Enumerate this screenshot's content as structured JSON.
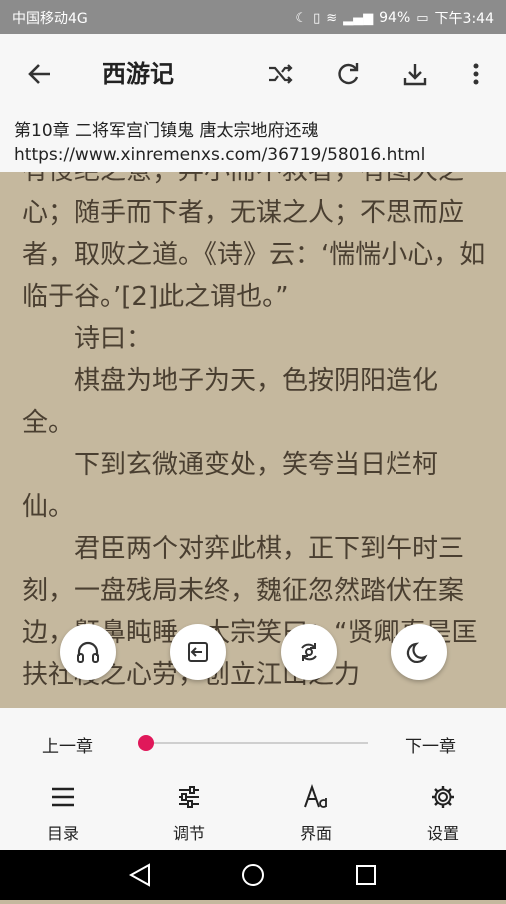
{
  "status": {
    "carrier": "中国移动4G",
    "battery": "94%",
    "time": "下午3:44"
  },
  "toolbar": {
    "title": "西游记"
  },
  "chapter": {
    "title": "第10章 二将军宫门镇鬼 唐太宗地府还魂",
    "url": "https://www.xinremenxs.com/36719/58016.html"
  },
  "content": {
    "paragraphs": [
      "有侵绝之意；弃小而不救者，有图大之心；随手而下者，无谋之人；不思而应者，取败之道。《诗》云：‘惴惴小心，如临于谷。’[2]此之谓也。”",
      "诗曰：",
      "棋盘为地子为天，色按阴阳造化全。",
      "下到玄微通变处，笑夸当日烂柯仙。",
      "君臣两个对弈此棋，正下到午时三刻，一盘残局未终，魏征忽然踏伏在案边，鼾鼻盹睡。太宗笑曰：“贤卿真是匡扶社稷之心劳，创立江山之力"
    ]
  },
  "bottom": {
    "prev_label": "上一章",
    "next_label": "下一章",
    "menu": [
      {
        "label": "目录"
      },
      {
        "label": "调节"
      },
      {
        "label": "界面"
      },
      {
        "label": "设置"
      }
    ]
  }
}
